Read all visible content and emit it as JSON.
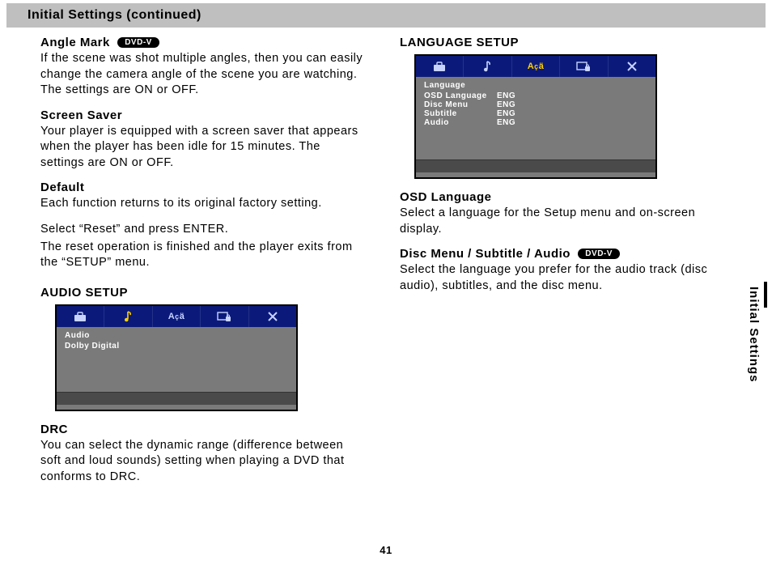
{
  "header": "Initial Settings (continued)",
  "side_tab": "Initial Settings",
  "page_number": "41",
  "badges": {
    "dvdv": "DVD-V"
  },
  "left": {
    "angle_mark": {
      "title": "Angle Mark",
      "text": "If the scene was shot multiple angles, then you can easily change the camera angle of the scene you are watching. The settings are ON or OFF."
    },
    "screen_saver": {
      "title": "Screen Saver",
      "text": "Your player is equipped with a screen saver that appears when the player has been idle for 15 minutes. The settings are ON or OFF."
    },
    "default": {
      "title": "Default",
      "line1": "Each function returns to its original factory setting.",
      "line2": "Select “Reset” and press ENTER.",
      "line3": "The reset operation is finished and the player exits from the “SETUP” menu."
    },
    "audio_setup": {
      "title": "AUDIO SETUP",
      "panel_header": "Audio",
      "row1": "Dolby Digital"
    },
    "drc": {
      "title": "DRC",
      "text": "You can select the dynamic range (difference between soft and loud sounds) setting when playing a DVD that conforms to DRC."
    }
  },
  "right": {
    "language_setup": {
      "title": "LANGUAGE SETUP",
      "panel_header": "Language",
      "rows": [
        {
          "k": "OSD Language",
          "v": "ENG"
        },
        {
          "k": "Disc Menu",
          "v": "ENG"
        },
        {
          "k": "Subtitle",
          "v": "ENG"
        },
        {
          "k": "Audio",
          "v": "ENG"
        }
      ]
    },
    "osd_language": {
      "title": "OSD Language",
      "text": "Select a language for the Setup menu and on-screen display."
    },
    "disc_menu": {
      "title": "Disc Menu / Subtitle / Audio",
      "text": "Select the language you prefer for the audio track (disc audio), subtitles, and the disc menu."
    }
  }
}
